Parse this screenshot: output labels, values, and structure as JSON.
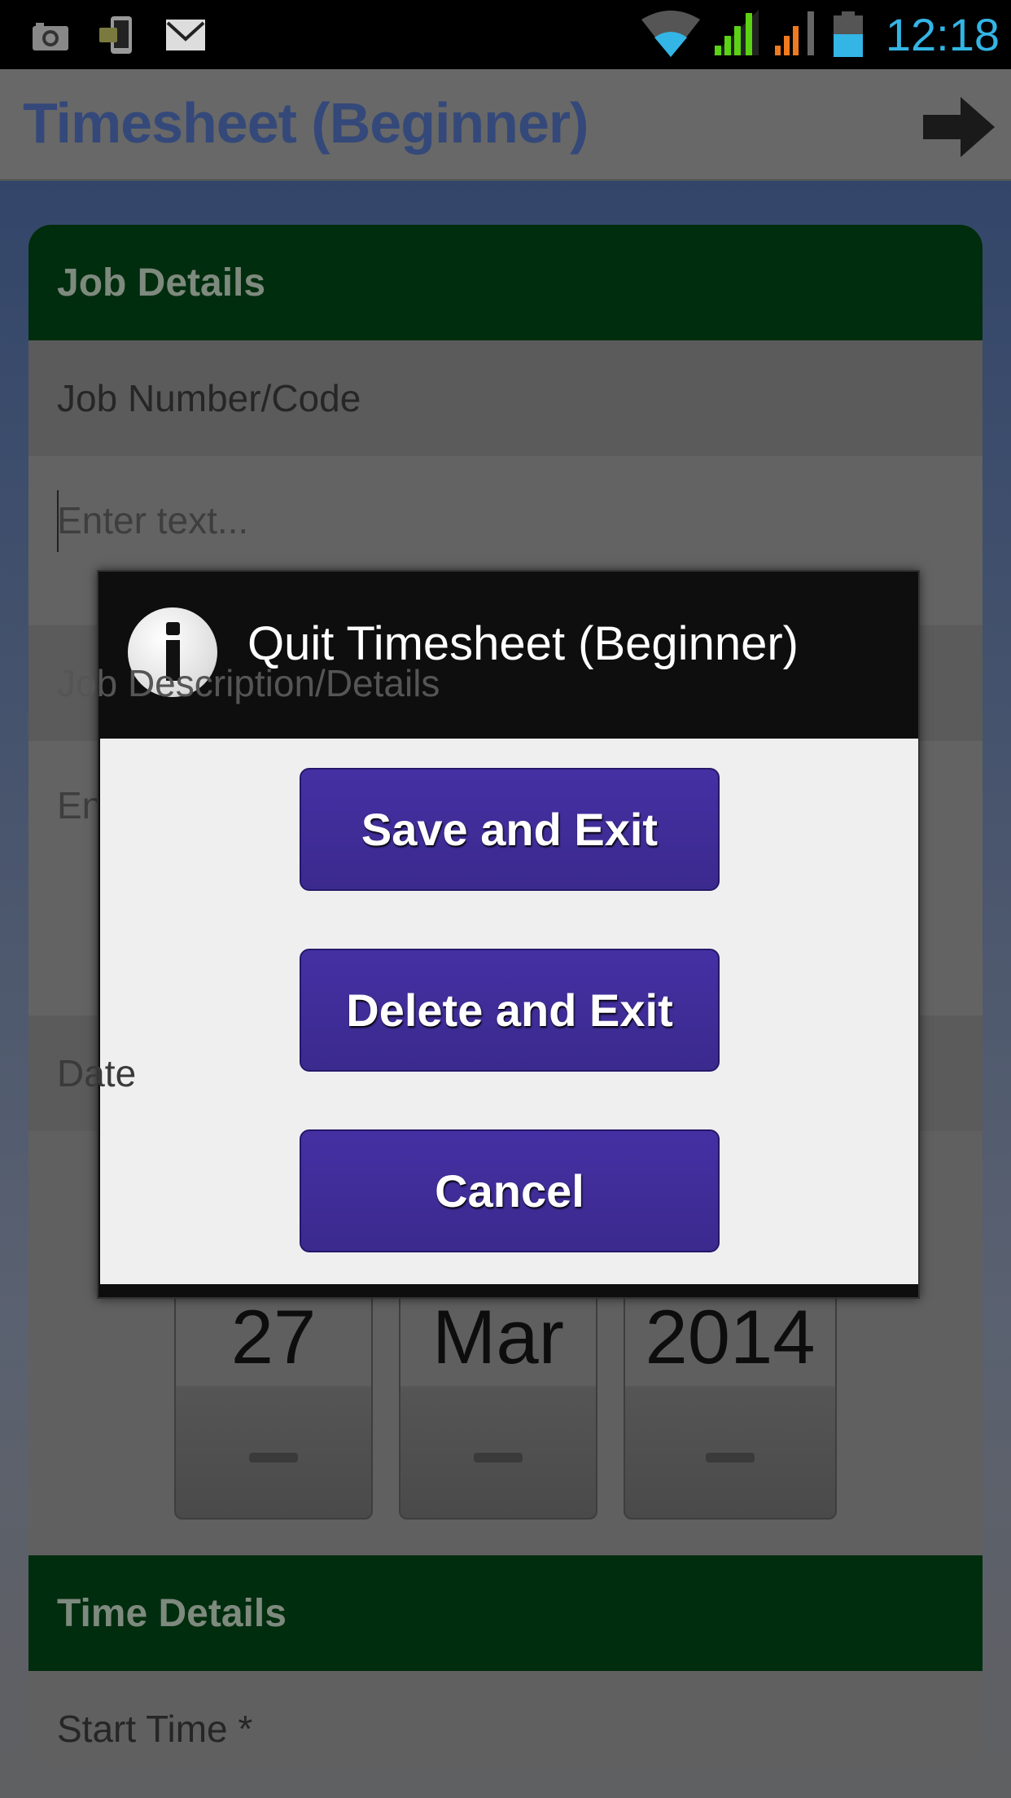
{
  "status_bar": {
    "time": "12:18",
    "icons": [
      "camera-icon",
      "phone-transfer-icon",
      "mail-icon",
      "wifi-icon",
      "signal-icon",
      "signal-roaming-icon",
      "battery-icon"
    ]
  },
  "app_bar": {
    "title": "Timesheet (Beginner)",
    "action_icon": "arrow-right-icon"
  },
  "form": {
    "job_details_header": "Job Details",
    "job_number_label": "Job Number/Code",
    "job_number_placeholder": "Enter text...",
    "job_description_label": "Job Description/Details",
    "job_description_placeholder": "Enter text...",
    "date_label": "Date",
    "date": {
      "day": "27",
      "month": "Mar",
      "year": "2014"
    },
    "time_details_header": "Time Details",
    "start_time_label": "Start Time *"
  },
  "dialog": {
    "title": "Quit Timesheet (Beginner)",
    "icon": "info-icon",
    "buttons": {
      "save": "Save and Exit",
      "delete": "Delete and Exit",
      "cancel": "Cancel"
    }
  },
  "colors": {
    "accent_button": "#4530a3",
    "section_header": "#006414",
    "title": "#3b5998",
    "clock": "#33b5e5"
  }
}
